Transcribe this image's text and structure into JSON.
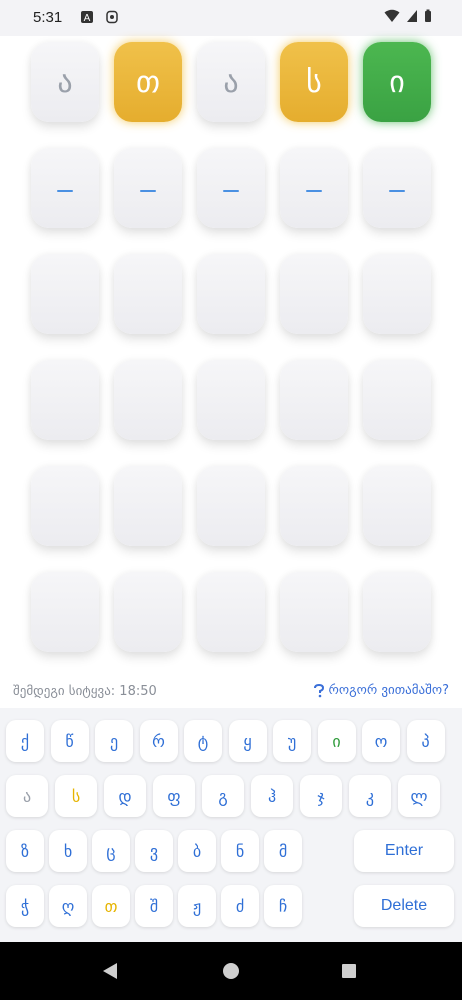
{
  "status_bar": {
    "time": "5:31"
  },
  "board": {
    "rows": [
      [
        {
          "letter": "ა",
          "state": "absent"
        },
        {
          "letter": "თ",
          "state": "present"
        },
        {
          "letter": "ა",
          "state": "absent"
        },
        {
          "letter": "ს",
          "state": "present"
        },
        {
          "letter": "ი",
          "state": "correct"
        }
      ],
      [
        {
          "letter": "",
          "state": "active"
        },
        {
          "letter": "",
          "state": "active"
        },
        {
          "letter": "",
          "state": "active"
        },
        {
          "letter": "",
          "state": "active"
        },
        {
          "letter": "",
          "state": "active"
        }
      ],
      [
        {
          "letter": "",
          "state": "empty"
        },
        {
          "letter": "",
          "state": "empty"
        },
        {
          "letter": "",
          "state": "empty"
        },
        {
          "letter": "",
          "state": "empty"
        },
        {
          "letter": "",
          "state": "empty"
        }
      ],
      [
        {
          "letter": "",
          "state": "empty"
        },
        {
          "letter": "",
          "state": "empty"
        },
        {
          "letter": "",
          "state": "empty"
        },
        {
          "letter": "",
          "state": "empty"
        },
        {
          "letter": "",
          "state": "empty"
        }
      ],
      [
        {
          "letter": "",
          "state": "empty"
        },
        {
          "letter": "",
          "state": "empty"
        },
        {
          "letter": "",
          "state": "empty"
        },
        {
          "letter": "",
          "state": "empty"
        },
        {
          "letter": "",
          "state": "empty"
        }
      ],
      [
        {
          "letter": "",
          "state": "empty"
        },
        {
          "letter": "",
          "state": "empty"
        },
        {
          "letter": "",
          "state": "empty"
        },
        {
          "letter": "",
          "state": "empty"
        },
        {
          "letter": "",
          "state": "empty"
        }
      ]
    ]
  },
  "info": {
    "next_word_label": "შემდეგი სიტყვა: 18:50",
    "help_label": "როგორ ვითამაშო?"
  },
  "keyboard": {
    "rows": [
      [
        {
          "key": "ქ",
          "state": "unused"
        },
        {
          "key": "წ",
          "state": "unused"
        },
        {
          "key": "ე",
          "state": "unused"
        },
        {
          "key": "რ",
          "state": "unused"
        },
        {
          "key": "ტ",
          "state": "unused"
        },
        {
          "key": "ყ",
          "state": "unused"
        },
        {
          "key": "უ",
          "state": "unused"
        },
        {
          "key": "ი",
          "state": "correct"
        },
        {
          "key": "ო",
          "state": "unused"
        },
        {
          "key": "პ",
          "state": "unused"
        }
      ],
      [
        {
          "key": "ა",
          "state": "absent"
        },
        {
          "key": "ს",
          "state": "present"
        },
        {
          "key": "დ",
          "state": "unused"
        },
        {
          "key": "ფ",
          "state": "unused"
        },
        {
          "key": "გ",
          "state": "unused"
        },
        {
          "key": "ჰ",
          "state": "unused"
        },
        {
          "key": "ჯ",
          "state": "unused"
        },
        {
          "key": "კ",
          "state": "unused"
        },
        {
          "key": "ლ",
          "state": "unused"
        }
      ],
      [
        {
          "key": "ზ",
          "state": "unused"
        },
        {
          "key": "ხ",
          "state": "unused"
        },
        {
          "key": "ც",
          "state": "unused"
        },
        {
          "key": "ვ",
          "state": "unused"
        },
        {
          "key": "ბ",
          "state": "unused"
        },
        {
          "key": "ნ",
          "state": "unused"
        },
        {
          "key": "მ",
          "state": "unused"
        },
        {
          "key": "Enter",
          "state": "action"
        }
      ],
      [
        {
          "key": "ჭ",
          "state": "unused"
        },
        {
          "key": "ღ",
          "state": "unused"
        },
        {
          "key": "თ",
          "state": "present"
        },
        {
          "key": "შ",
          "state": "unused"
        },
        {
          "key": "ჟ",
          "state": "unused"
        },
        {
          "key": "ძ",
          "state": "unused"
        },
        {
          "key": "ჩ",
          "state": "unused"
        },
        {
          "key": "Delete",
          "state": "action"
        }
      ]
    ]
  },
  "colors": {
    "present": "#e6b400",
    "correct": "#3aa243",
    "key_text": "#2f6fd6",
    "absent": "#9aa0aa"
  }
}
